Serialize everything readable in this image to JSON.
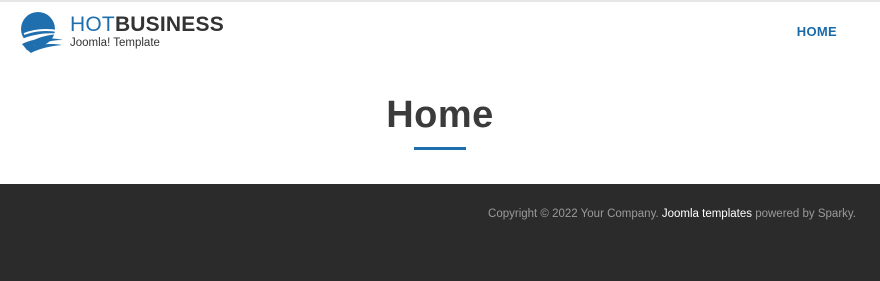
{
  "header": {
    "brand_prefix": "HOT",
    "brand_suffix": "BUSINESS",
    "tagline": "Joomla! Template",
    "nav_items": [
      "HOME"
    ]
  },
  "main": {
    "page_title": "Home"
  },
  "footer": {
    "copyright_prefix": "Copyright © 2022 Your Company.",
    "link_text": "Joomla templates",
    "copyright_suffix": "powered by Sparky."
  },
  "colors": {
    "accent": "#1f6fae",
    "nav": "#1a6aa8",
    "footer_bg": "#2b2b2b",
    "title": "#3b3b3b"
  },
  "icons": {
    "logo": "globe-swoosh-logo-icon"
  }
}
